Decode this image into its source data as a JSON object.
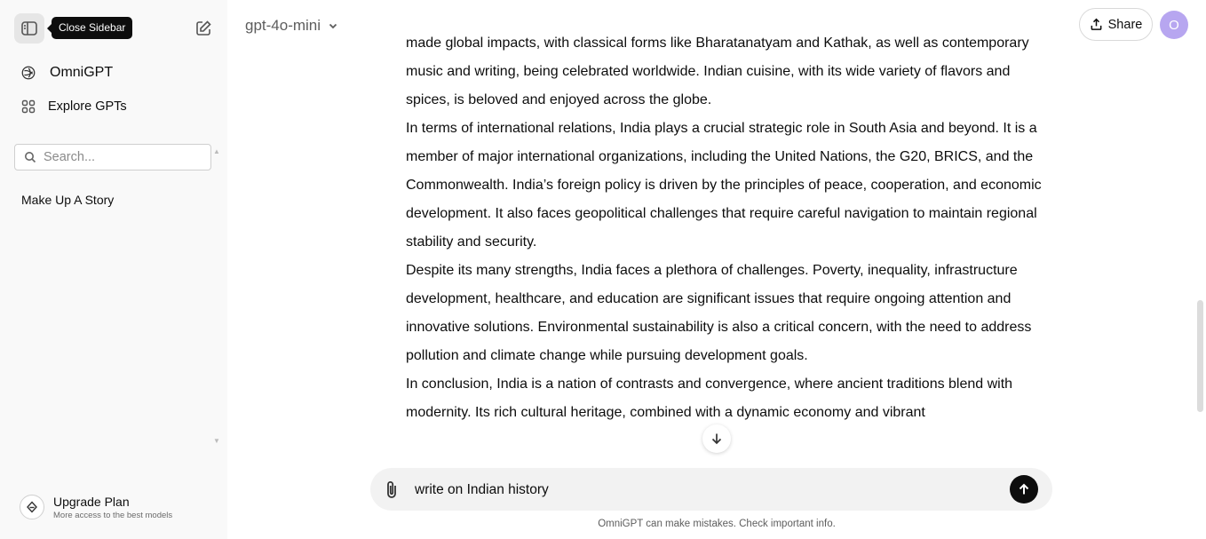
{
  "sidebar": {
    "toggle_tooltip": "Close Sidebar",
    "nav": {
      "omni_label": "OmniGPT",
      "explore_label": "Explore GPTs"
    },
    "search_placeholder": "Search...",
    "chats": [
      "Make Up A Story"
    ],
    "upgrade": {
      "title": "Upgrade Plan",
      "subtitle": "More access to the best models"
    }
  },
  "header": {
    "model": "gpt-4o-mini",
    "share_label": "Share",
    "avatar_initial": "O"
  },
  "conversation": {
    "paragraphs": [
      "made global impacts, with classical forms like Bharatanatyam and Kathak, as well as contemporary music and writing, being celebrated worldwide. Indian cuisine, with its wide variety of flavors and spices, is beloved and enjoyed across the globe.",
      "In terms of international relations, India plays a crucial strategic role in South Asia and beyond. It is a member of major international organizations, including the United Nations, the G20, BRICS, and the Commonwealth. India’s foreign policy is driven by the principles of peace, cooperation, and economic development. It also faces geopolitical challenges that require careful navigation to maintain regional stability and security.",
      "Despite its many strengths, India faces a plethora of challenges. Poverty, inequality, infrastructure development, healthcare, and education are significant issues that require ongoing attention and innovative solutions. Environmental sustainability is also a critical concern, with the need to address pollution and climate change while pursuing development goals.",
      "In conclusion, India is a nation of contrasts and convergence, where ancient traditions blend with modernity. Its rich cultural heritage, combined with a dynamic economy and vibrant"
    ]
  },
  "composer": {
    "value": "write on Indian history"
  },
  "footer": {
    "disclaimer": "OmniGPT can make mistakes. Check important info."
  },
  "colors": {
    "sidebar_bg": "#f9f9f9",
    "avatar_bg": "#b7a6f0",
    "send_bg": "#0d0d0d",
    "composer_bg": "#f2f2f2"
  }
}
